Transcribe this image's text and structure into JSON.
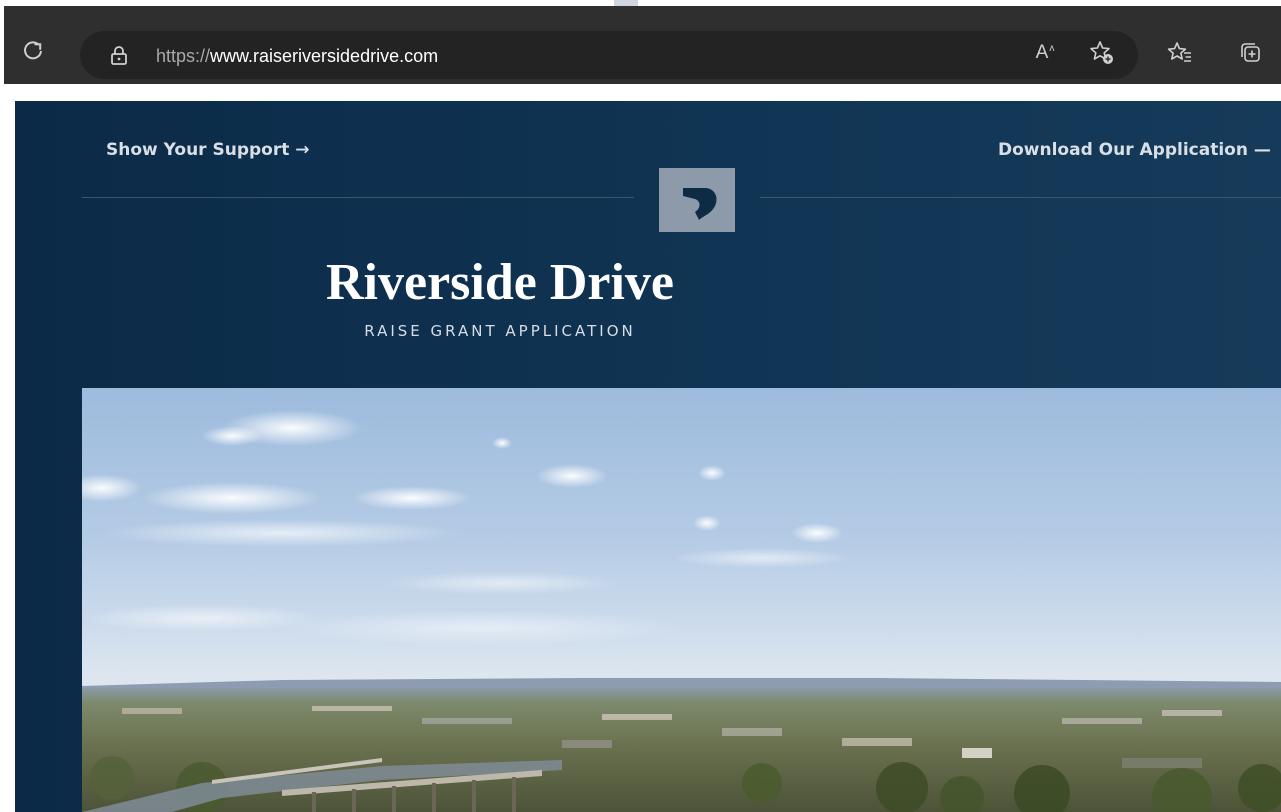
{
  "browser": {
    "url_protocol": "https://",
    "url_host": "www.raiseriversidedrive.com",
    "read_aloud_label": "A",
    "icons": {
      "reload": "reload-icon",
      "lock": "lock-icon",
      "read_aloud": "read-aloud-icon",
      "add_favorite": "add-favorite-icon",
      "favorites": "favorites-icon",
      "collections": "collections-icon"
    }
  },
  "page": {
    "nav": {
      "left_link": "Show Your Support →",
      "right_link": "Download Our Application —"
    },
    "title": "Riverside Drive",
    "subtitle": "RAISE GRANT APPLICATION",
    "colors": {
      "background": "#0b2a47",
      "logo_tile": "#8c9aaa",
      "text": "#ffffff"
    }
  }
}
